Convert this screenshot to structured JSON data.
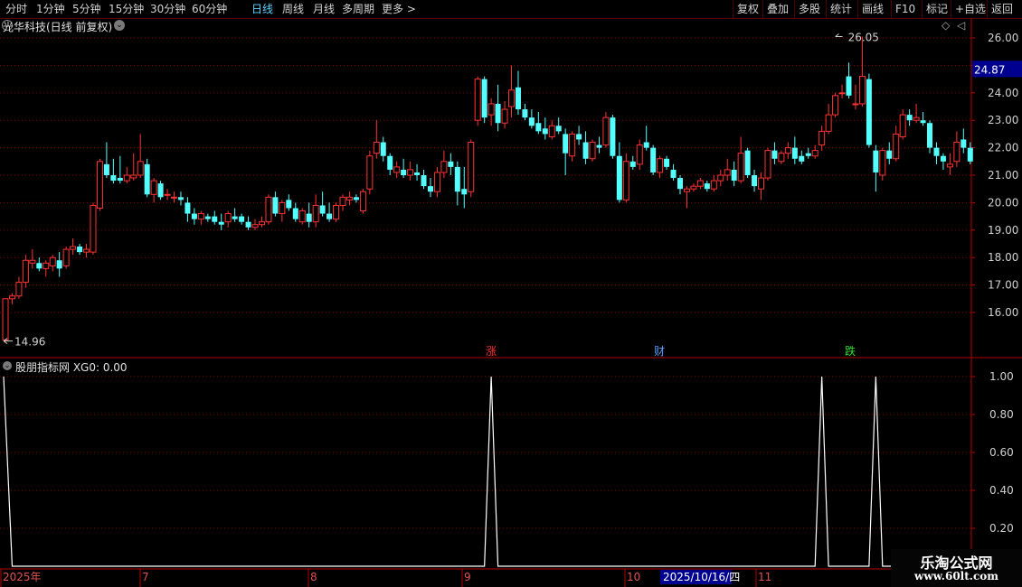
{
  "toolbar": {
    "left_items": [
      "分时",
      "1分钟",
      "5分钟",
      "15分钟",
      "30分钟",
      "60分钟",
      "日线",
      "周线",
      "月线",
      "多周期",
      "更多 >"
    ],
    "active": "日线",
    "right_items": [
      "复权",
      "叠加",
      "多股",
      "统计",
      "画线",
      "F10",
      "标记",
      "+自选",
      "返回"
    ]
  },
  "main_panel": {
    "title": "光华科技(日线 前复权)",
    "current_price": "24.87",
    "high_marker": "26.05",
    "low_marker": "14.96",
    "y_ticks": [
      "26.00",
      "25.00",
      "24.00",
      "23.00",
      "22.00",
      "21.00",
      "20.00",
      "19.00",
      "18.00",
      "17.00",
      "16.00"
    ],
    "event_markers": [
      {
        "text": "涨",
        "color": "#ff3030"
      },
      {
        "text": "财",
        "color": "#5a9cff"
      },
      {
        "text": "跌",
        "color": "#30e030"
      }
    ]
  },
  "indicator_panel": {
    "title": "股朋指标网 XG0: 0.00",
    "y_ticks": [
      "1.00",
      "0.80",
      "0.60",
      "0.40",
      "0.20"
    ]
  },
  "date_axis": {
    "labels": [
      "2025年",
      "7",
      "8",
      "9",
      "10",
      "11"
    ],
    "cursor_label": "2025/10/16/四"
  },
  "watermark": {
    "line1": "乐淘公式网",
    "line2": "www.60lt.com"
  },
  "colors": {
    "up": "#ff3232",
    "down": "#54ffff",
    "grid": "#8a0000",
    "axis": "#b40000",
    "signal": "#ffffff",
    "price_box": "#000090"
  },
  "chart_data": {
    "type": "candlestick",
    "ylim": [
      14.6,
      26.6
    ],
    "candles": [
      [
        15.0,
        16.5,
        14.96,
        16.5
      ],
      [
        16.5,
        16.7,
        16.3,
        16.6
      ],
      [
        16.6,
        17.3,
        16.5,
        17.1
      ],
      [
        17.1,
        18.1,
        16.9,
        17.9
      ],
      [
        17.8,
        18.3,
        17.6,
        17.9
      ],
      [
        17.8,
        18.0,
        17.5,
        17.6
      ],
      [
        17.6,
        17.9,
        17.3,
        17.8
      ],
      [
        17.7,
        18.1,
        17.5,
        18.0
      ],
      [
        17.9,
        18.2,
        17.3,
        17.6
      ],
      [
        17.7,
        18.4,
        17.6,
        18.3
      ],
      [
        18.3,
        18.7,
        18.1,
        18.4
      ],
      [
        18.4,
        18.5,
        18.1,
        18.2
      ],
      [
        18.2,
        18.5,
        18.0,
        18.3
      ],
      [
        18.2,
        20.0,
        18.1,
        19.9
      ],
      [
        19.8,
        21.6,
        19.7,
        21.5
      ],
      [
        21.4,
        22.2,
        20.9,
        21.0
      ],
      [
        21.0,
        21.6,
        20.7,
        20.8
      ],
      [
        20.9,
        21.7,
        20.7,
        20.8
      ],
      [
        20.8,
        21.3,
        20.7,
        21.0
      ],
      [
        20.9,
        21.8,
        20.8,
        21.0
      ],
      [
        21.0,
        22.5,
        20.9,
        21.5
      ],
      [
        21.4,
        21.6,
        20.2,
        20.3
      ],
      [
        20.3,
        20.9,
        20.0,
        20.8
      ],
      [
        20.7,
        20.8,
        20.1,
        20.2
      ],
      [
        20.3,
        20.5,
        20.1,
        20.3
      ],
      [
        20.2,
        20.4,
        20.0,
        20.2
      ],
      [
        20.2,
        20.4,
        19.9,
        20.1
      ],
      [
        20.0,
        20.2,
        19.3,
        19.6
      ],
      [
        19.6,
        19.8,
        19.2,
        19.4
      ],
      [
        19.4,
        19.7,
        19.2,
        19.6
      ],
      [
        19.5,
        19.6,
        19.3,
        19.4
      ],
      [
        19.5,
        19.7,
        19.2,
        19.3
      ],
      [
        19.3,
        19.6,
        19.0,
        19.2
      ],
      [
        19.3,
        19.7,
        19.1,
        19.6
      ],
      [
        19.5,
        19.8,
        19.3,
        19.4
      ],
      [
        19.5,
        19.6,
        19.2,
        19.3
      ],
      [
        19.3,
        19.5,
        19.0,
        19.1
      ],
      [
        19.1,
        19.4,
        19.0,
        19.2
      ],
      [
        19.2,
        19.5,
        19.1,
        19.3
      ],
      [
        19.3,
        20.3,
        19.2,
        20.2
      ],
      [
        20.2,
        20.4,
        19.5,
        19.6
      ],
      [
        19.6,
        20.1,
        19.3,
        20.0
      ],
      [
        20.1,
        20.3,
        19.7,
        19.8
      ],
      [
        19.8,
        20.0,
        19.3,
        19.4
      ],
      [
        19.3,
        19.8,
        19.2,
        19.7
      ],
      [
        19.6,
        20.0,
        19.1,
        19.3
      ],
      [
        19.3,
        20.3,
        19.1,
        19.9
      ],
      [
        19.9,
        20.4,
        19.5,
        19.6
      ],
      [
        19.6,
        20.0,
        19.3,
        19.4
      ],
      [
        19.4,
        20.0,
        19.3,
        19.9
      ],
      [
        19.9,
        20.3,
        19.7,
        20.2
      ],
      [
        20.1,
        20.4,
        19.9,
        20.2
      ],
      [
        20.2,
        20.3,
        20.0,
        20.1
      ],
      [
        19.7,
        20.5,
        19.6,
        20.4
      ],
      [
        20.5,
        21.9,
        20.3,
        21.7
      ],
      [
        21.8,
        23.0,
        21.6,
        22.2
      ],
      [
        22.2,
        22.4,
        21.5,
        21.7
      ],
      [
        21.7,
        21.8,
        21.0,
        21.2
      ],
      [
        21.1,
        21.5,
        20.9,
        21.3
      ],
      [
        21.2,
        21.6,
        20.9,
        21.0
      ],
      [
        21.0,
        21.5,
        20.8,
        21.2
      ],
      [
        21.1,
        21.4,
        20.8,
        21.0
      ],
      [
        21.0,
        21.2,
        20.5,
        20.6
      ],
      [
        20.6,
        20.9,
        20.2,
        20.4
      ],
      [
        20.4,
        21.3,
        20.2,
        21.1
      ],
      [
        21.1,
        21.9,
        20.9,
        21.5
      ],
      [
        21.5,
        21.8,
        21.0,
        21.3
      ],
      [
        21.3,
        21.5,
        19.9,
        20.4
      ],
      [
        20.5,
        21.3,
        19.8,
        20.3
      ],
      [
        20.4,
        22.3,
        20.2,
        22.2
      ],
      [
        23.0,
        24.6,
        22.8,
        24.5
      ],
      [
        24.5,
        24.6,
        22.9,
        23.1
      ],
      [
        23.2,
        23.8,
        22.8,
        23.6
      ],
      [
        23.6,
        24.3,
        22.6,
        22.9
      ],
      [
        22.9,
        23.7,
        22.7,
        23.4
      ],
      [
        23.5,
        25.0,
        23.1,
        24.1
      ],
      [
        24.2,
        24.8,
        23.2,
        23.4
      ],
      [
        23.4,
        23.6,
        23.0,
        23.1
      ],
      [
        23.1,
        23.4,
        22.7,
        22.8
      ],
      [
        22.9,
        23.3,
        22.5,
        22.6
      ],
      [
        22.7,
        23.1,
        22.3,
        22.5
      ],
      [
        22.4,
        23.0,
        22.3,
        22.8
      ],
      [
        22.8,
        23.1,
        22.5,
        22.6
      ],
      [
        22.5,
        22.7,
        21.0,
        21.8
      ],
      [
        21.7,
        22.6,
        21.5,
        22.5
      ],
      [
        22.5,
        22.8,
        22.1,
        22.3
      ],
      [
        22.2,
        22.6,
        21.4,
        21.6
      ],
      [
        21.6,
        22.3,
        21.5,
        22.2
      ],
      [
        22.1,
        22.4,
        21.8,
        22.0
      ],
      [
        22.1,
        23.3,
        22.0,
        23.1
      ],
      [
        23.1,
        23.2,
        21.6,
        21.7
      ],
      [
        21.7,
        22.2,
        20.0,
        20.1
      ],
      [
        20.1,
        21.8,
        20.0,
        21.5
      ],
      [
        21.5,
        21.7,
        21.2,
        21.3
      ],
      [
        21.4,
        22.3,
        21.2,
        22.1
      ],
      [
        22.2,
        22.8,
        21.9,
        22.0
      ],
      [
        22.0,
        22.1,
        21.0,
        21.1
      ],
      [
        21.1,
        21.7,
        20.9,
        21.6
      ],
      [
        21.6,
        21.7,
        21.2,
        21.3
      ],
      [
        21.2,
        21.4,
        20.8,
        20.9
      ],
      [
        20.9,
        21.0,
        20.3,
        20.5
      ],
      [
        20.4,
        20.6,
        19.8,
        20.5
      ],
      [
        20.5,
        20.7,
        20.4,
        20.6
      ],
      [
        20.6,
        20.9,
        20.5,
        20.8
      ],
      [
        20.7,
        20.8,
        20.4,
        20.5
      ],
      [
        20.5,
        21.0,
        20.4,
        20.8
      ],
      [
        20.8,
        21.2,
        20.6,
        21.0
      ],
      [
        21.0,
        21.6,
        20.8,
        21.2
      ],
      [
        21.2,
        21.5,
        20.6,
        20.8
      ],
      [
        20.8,
        22.4,
        20.7,
        21.8
      ],
      [
        21.9,
        22.0,
        20.9,
        21.0
      ],
      [
        21.0,
        21.2,
        20.4,
        20.6
      ],
      [
        20.5,
        21.1,
        20.1,
        20.9
      ],
      [
        20.9,
        22.0,
        20.8,
        21.9
      ],
      [
        21.9,
        22.2,
        21.4,
        21.6
      ],
      [
        21.5,
        21.9,
        21.4,
        21.8
      ],
      [
        21.8,
        22.2,
        21.6,
        22.0
      ],
      [
        22.0,
        22.4,
        21.4,
        21.6
      ],
      [
        21.7,
        21.9,
        21.4,
        21.5
      ],
      [
        21.8,
        22.0,
        21.6,
        21.7
      ],
      [
        21.7,
        22.1,
        21.6,
        21.9
      ],
      [
        22.1,
        22.8,
        21.9,
        22.6
      ],
      [
        22.6,
        23.6,
        22.5,
        23.2
      ],
      [
        23.2,
        24.0,
        23.1,
        23.9
      ],
      [
        24.0,
        24.3,
        23.8,
        24.0
      ],
      [
        24.6,
        25.1,
        23.8,
        23.9
      ],
      [
        23.6,
        24.3,
        23.4,
        23.6
      ],
      [
        23.6,
        26.05,
        23.5,
        24.6
      ],
      [
        24.5,
        24.7,
        22.0,
        22.1
      ],
      [
        21.9,
        22.1,
        20.4,
        21.1
      ],
      [
        21.0,
        22.0,
        20.8,
        21.9
      ],
      [
        21.9,
        22.2,
        21.4,
        21.6
      ],
      [
        21.6,
        22.8,
        21.5,
        22.5
      ],
      [
        22.4,
        23.4,
        22.3,
        23.2
      ],
      [
        23.2,
        23.4,
        22.8,
        23.0
      ],
      [
        23.0,
        23.6,
        22.9,
        23.1
      ],
      [
        23.0,
        23.3,
        22.8,
        22.9
      ],
      [
        22.9,
        23.0,
        21.8,
        22.0
      ],
      [
        22.0,
        22.2,
        21.4,
        21.7
      ],
      [
        21.7,
        21.8,
        21.2,
        21.5
      ],
      [
        21.3,
        21.8,
        21.0,
        21.4
      ],
      [
        21.5,
        22.6,
        21.3,
        22.2
      ],
      [
        22.3,
        22.7,
        21.8,
        22.0
      ],
      [
        22.0,
        22.2,
        21.4,
        21.5
      ]
    ],
    "signal": {
      "label": "XG0",
      "ylim": [
        0.0,
        1.05
      ],
      "spike_indices": [
        0,
        72,
        121,
        129
      ],
      "values": "0 everywhere except 1.00 at spike_indices"
    }
  }
}
